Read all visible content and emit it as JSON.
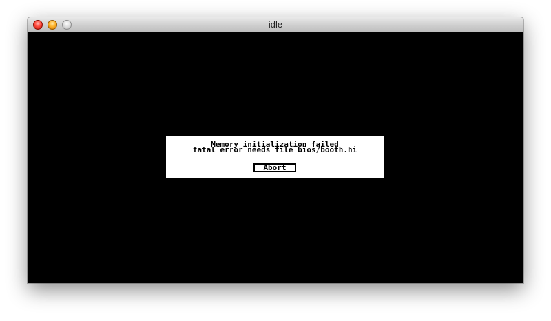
{
  "window": {
    "title": "idle"
  },
  "dialog": {
    "line1": "Memory initialization failed",
    "line2": "fatal error needs file bios/booth.hi",
    "abort_label": "Abort"
  }
}
